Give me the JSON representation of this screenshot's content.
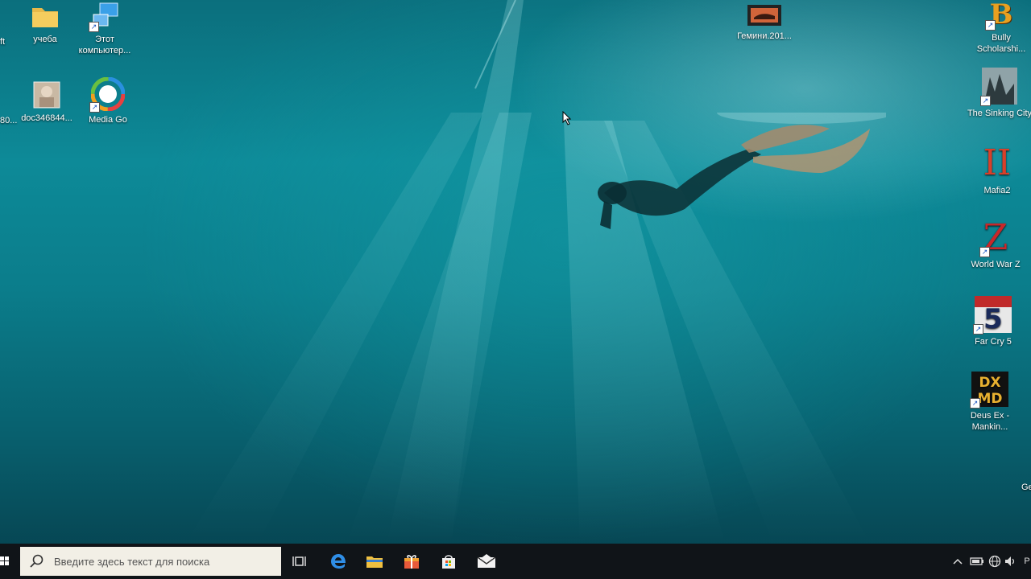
{
  "desktop": {
    "icons_left": [
      {
        "name": "folder-icon",
        "label": "учеба"
      },
      {
        "name": "computer-icon",
        "label": "Этот компьютер..."
      },
      {
        "name": "image-file-icon",
        "label": "doc346844..."
      },
      {
        "name": "media-go-icon",
        "label": "Media Go"
      }
    ],
    "icons_left_partial": [
      "ft",
      "80..."
    ],
    "icon_top_center": {
      "name": "video-file-icon",
      "label": "Гемини.201..."
    },
    "icons_right": [
      {
        "name": "bully-icon",
        "label": "Bully Scholarshi..."
      },
      {
        "name": "sinking-city-icon",
        "label": "The Sinking City"
      },
      {
        "name": "mafia2-icon",
        "label": "Mafia2"
      },
      {
        "name": "world-war-z-icon",
        "label": "World War Z"
      },
      {
        "name": "far-cry-5-icon",
        "label": "Far Cry 5"
      },
      {
        "name": "deus-ex-icon",
        "label": "Deus Ex - Mankin..."
      }
    ],
    "icons_right_partial": [
      "Ge"
    ]
  },
  "taskbar": {
    "search_placeholder": "Введите здесь текст для поиска",
    "apps": [
      "task-view-icon",
      "edge-icon",
      "file-explorer-icon",
      "gift-icon",
      "store-icon",
      "mail-icon"
    ],
    "tray": [
      "chevron-up-icon",
      "battery-icon",
      "network-icon",
      "volume-icon"
    ],
    "lang_partial": "P"
  }
}
